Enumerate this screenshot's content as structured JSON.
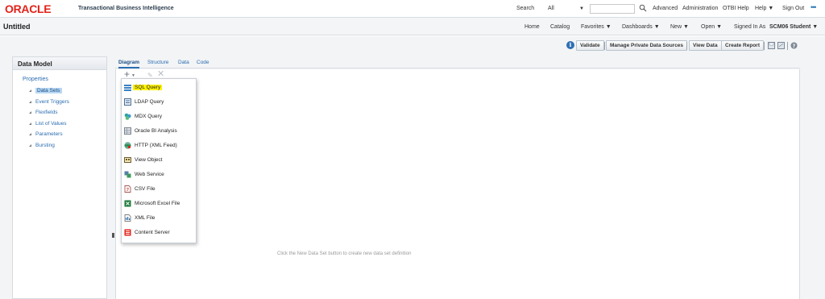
{
  "brand": {
    "logo": "ORACLE",
    "app_name": "Transactional Business Intelligence"
  },
  "search": {
    "label": "Search",
    "scope": "All"
  },
  "top_links": [
    "Advanced",
    "Administration",
    "OTBI Help",
    "Help ▼",
    "Sign Out"
  ],
  "page_title": "Untitled",
  "nav": {
    "home": "Home",
    "catalog": "Catalog",
    "favorites": "Favorites ▼",
    "dashboards": "Dashboards ▼",
    "new": "New ▼",
    "open": "Open ▼",
    "signed_in_label": "Signed In As",
    "user": "SCM06 Student ▼"
  },
  "toolbar": {
    "validate": "Validate",
    "manage_sources": "Manage Private Data Sources",
    "view_data": "View Data",
    "create_report": "Create Report"
  },
  "left_panel": {
    "title": "Data Model",
    "root": "Properties",
    "items": [
      "Data Sets",
      "Event Triggers",
      "Flexfields",
      "List of Values",
      "Parameters",
      "Bursting"
    ]
  },
  "tabs": [
    "Diagram",
    "Structure",
    "Data",
    "Code"
  ],
  "menu": [
    "SQL Query",
    "LDAP Query",
    "MDX Query",
    "Oracle BI Analysis",
    "HTTP (XML Feed)",
    "View Object",
    "Web Service",
    "CSV File",
    "Microsoft Excel File",
    "XML File",
    "Content Server"
  ],
  "hint": "Click the New Data Set button to create new data set definition",
  "colors": {
    "brand_red": "#e2231a",
    "link_blue": "#2a6db0",
    "highlight": "#fff200"
  }
}
